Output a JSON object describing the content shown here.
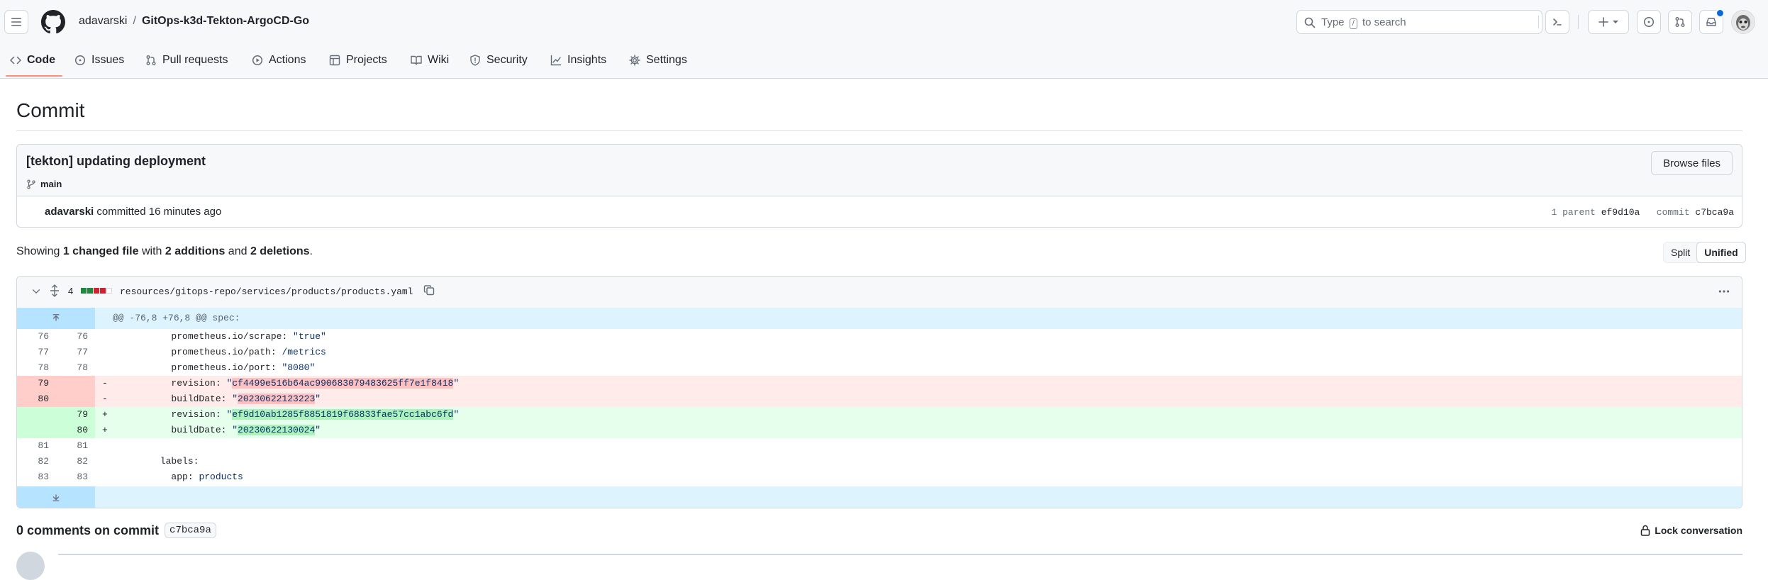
{
  "header": {
    "owner": "adavarski",
    "separator": "/",
    "repo": "GitOps-k3d-Tekton-ArgoCD-Go",
    "search": {
      "prefix": "Type",
      "key": "/",
      "suffix": "to search"
    }
  },
  "nav": {
    "tabs": [
      {
        "label": "Code",
        "icon": "code-icon"
      },
      {
        "label": "Issues",
        "icon": "issue-icon"
      },
      {
        "label": "Pull requests",
        "icon": "pull-request-icon"
      },
      {
        "label": "Actions",
        "icon": "play-icon"
      },
      {
        "label": "Projects",
        "icon": "table-icon"
      },
      {
        "label": "Wiki",
        "icon": "book-icon"
      },
      {
        "label": "Security",
        "icon": "shield-icon"
      },
      {
        "label": "Insights",
        "icon": "graph-icon"
      },
      {
        "label": "Settings",
        "icon": "gear-icon"
      }
    ]
  },
  "page": {
    "title": "Commit"
  },
  "commit": {
    "message": "[tekton] updating deployment",
    "branch": "main",
    "browse_label": "Browse files",
    "author": "adavarski",
    "action": "committed",
    "time": "16 minutes ago",
    "parent_label": "1 parent",
    "parent_sha": "ef9d10a",
    "commit_label": "commit",
    "commit_sha": "c7bca9a"
  },
  "summary": {
    "showing": "Showing",
    "files": "1 changed file",
    "with": "with",
    "additions": "2 additions",
    "and": "and",
    "deletions": "2 deletions",
    "end": "."
  },
  "view_toggle": {
    "split": "Split",
    "unified": "Unified",
    "selected": "Unified"
  },
  "diff": {
    "change_count": "4",
    "path": "resources/gitops-repo/services/products/products.yaml",
    "hunk": "@@ -76,8 +76,8 @@ spec:",
    "lines": [
      {
        "type": "ctx",
        "old": "76",
        "new": "76",
        "sign": "",
        "key": "        prometheus.io/scrape",
        "val": "\"true\""
      },
      {
        "type": "ctx",
        "old": "77",
        "new": "77",
        "sign": "",
        "key": "        prometheus.io/path",
        "val": "/metrics"
      },
      {
        "type": "ctx",
        "old": "78",
        "new": "78",
        "sign": "",
        "key": "        prometheus.io/port",
        "val": "\"8080\""
      },
      {
        "type": "del",
        "old": "79",
        "new": "",
        "sign": "-",
        "key": "        revision",
        "val": "cf4499e516b64ac990683079483625ff7e1f8418"
      },
      {
        "type": "del",
        "old": "80",
        "new": "",
        "sign": "-",
        "key": "        buildDate",
        "val": "20230622123223"
      },
      {
        "type": "add",
        "old": "",
        "new": "79",
        "sign": "+",
        "key": "        revision",
        "val": "ef9d10ab1285f8851819f68833fae57cc1abc6fd"
      },
      {
        "type": "add",
        "old": "",
        "new": "80",
        "sign": "+",
        "key": "        buildDate",
        "val": "20230622130024"
      },
      {
        "type": "ctx",
        "old": "81",
        "new": "81",
        "sign": "",
        "key": "",
        "val": ""
      },
      {
        "type": "ctx",
        "old": "82",
        "new": "82",
        "sign": "",
        "key": "      labels",
        "val": ""
      },
      {
        "type": "ctx",
        "old": "83",
        "new": "83",
        "sign": "",
        "key": "        app",
        "val": "products"
      }
    ]
  },
  "comments": {
    "label": "0 comments on commit",
    "sha": "c7bca9a",
    "lock_label": "Lock conversation"
  },
  "colors": {
    "accent": "#0969da",
    "tab_underline": "#fd8c73",
    "add_bg": "#e6ffec",
    "del_bg": "#ffebe9",
    "hunk_bg": "#ddf4ff"
  }
}
